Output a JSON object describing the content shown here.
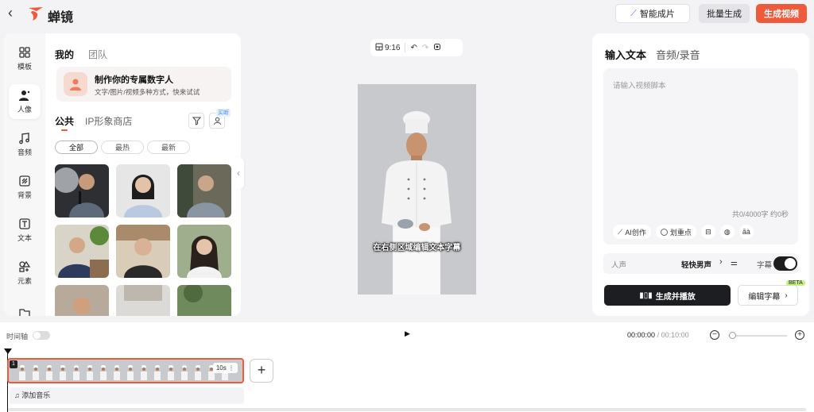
{
  "app": {
    "brand": "蝉镜"
  },
  "topbar": {
    "smart_label": "智能成片",
    "batch_label": "批量生成",
    "generate_label": "生成视频"
  },
  "rail": [
    {
      "label": "模板"
    },
    {
      "label": "人像"
    },
    {
      "label": "音频"
    },
    {
      "label": "背景"
    },
    {
      "label": "文本"
    },
    {
      "label": "元素"
    }
  ],
  "left": {
    "tab_mine": "我的",
    "tab_team": "团队",
    "promo_title": "制作你的专属数字人",
    "promo_sub": "文字/图片/视频多种方式，快来试试",
    "tab_public": "公共",
    "tab_ip": "IP形象商店",
    "badge_buy": "买断",
    "chips": [
      "全部",
      "最热",
      "最新"
    ]
  },
  "preview": {
    "ratio": "9:16",
    "subtitle": "在右侧区域编辑文本字幕"
  },
  "right": {
    "tab_text": "输入文本",
    "tab_audio": "音频/录音",
    "placeholder": "请输入视频脚本",
    "count": "共0/4000字 约0秒",
    "ai_label": "AI创作",
    "mark_label": "划重点",
    "pinyin_label": "āà",
    "voice_label": "人声",
    "voice_value": "轻快男声",
    "subtitle_label": "字幕",
    "play_label": "生成并播放",
    "edit_sub_label": "编辑字幕",
    "beta": "BETA"
  },
  "timeline": {
    "label": "时间轴",
    "current": "00:00:00",
    "separator": "/",
    "total": "00:10:00",
    "clip_number": "1",
    "clip_duration": "10s",
    "music_label": "添加音乐"
  }
}
